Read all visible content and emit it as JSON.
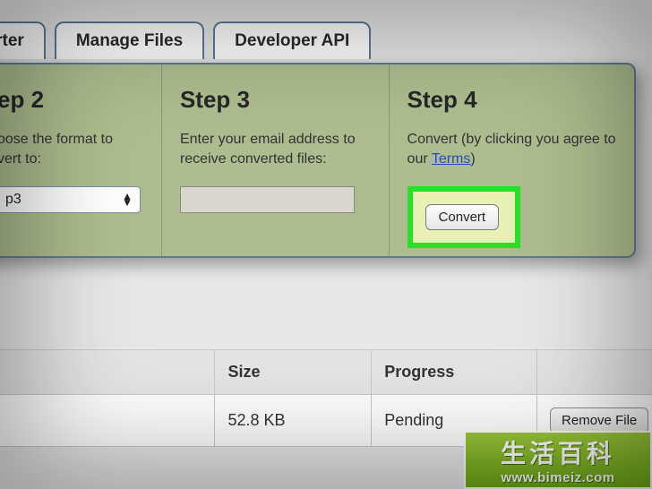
{
  "tabs": {
    "t1": "verter",
    "t2": "Manage Files",
    "t3": "Developer API"
  },
  "steps": {
    "s2": {
      "title": "ep 2",
      "desc_a": "oose the format to",
      "desc_b": "vert to:",
      "format_value": "p3"
    },
    "s3": {
      "title": "Step 3",
      "desc": "Enter your email address to receive converted files:",
      "email_value": ""
    },
    "s4": {
      "title": "Step 4",
      "desc_a": "Convert (by clicking you agree to our ",
      "terms_link": "Terms",
      "desc_b": ")",
      "convert_label": "Convert"
    }
  },
  "table": {
    "headers": {
      "size": "Size",
      "progress": "Progress"
    },
    "rows": [
      {
        "size": "52.8 KB",
        "progress": "Pending",
        "remove": "Remove File"
      }
    ]
  },
  "watermark": {
    "cn": "生活百科",
    "url": "www.bimeiz.com"
  }
}
